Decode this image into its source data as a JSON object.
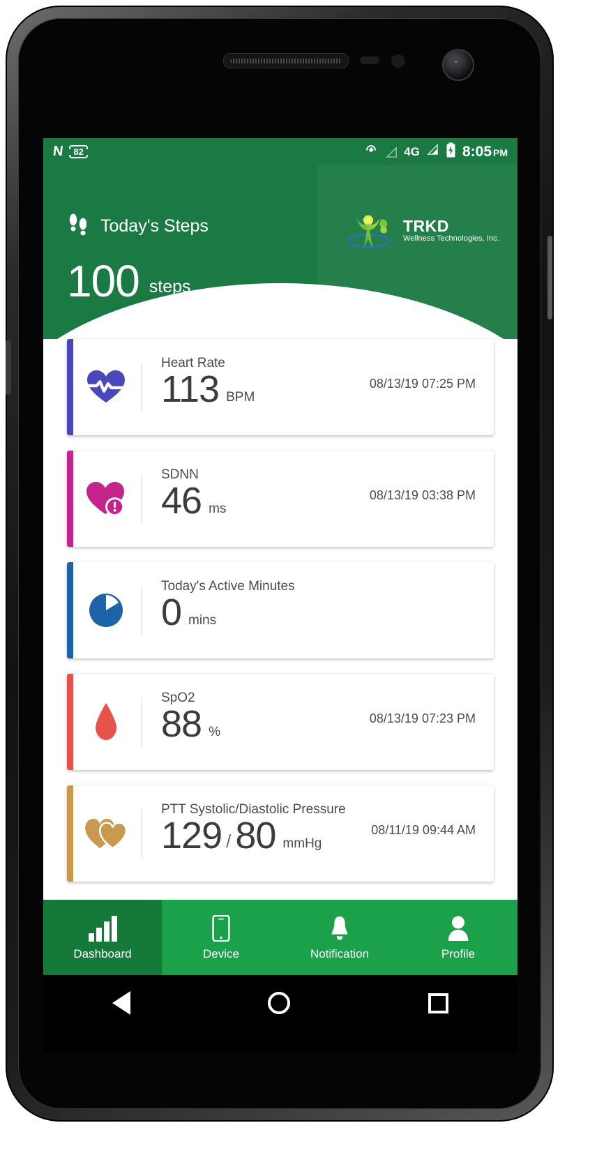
{
  "status_bar": {
    "notification_icon": "android-n-logo-icon",
    "battery_badge": "82",
    "icons": [
      "cast-icon",
      "signal-empty-icon",
      "signal-icon"
    ],
    "network": "4G",
    "time": "8:05",
    "ampm": "PM"
  },
  "header": {
    "steps_icon": "footsteps-icon",
    "steps_title": "Today's Steps",
    "steps_value": "100",
    "steps_unit": "steps",
    "brand_logo": "trkd-wellness-logo-icon",
    "brand_name": "TRKD",
    "brand_tagline": "Wellness Technologies, Inc.",
    "bg_color": "#1b7a43"
  },
  "cards": [
    {
      "name": "heart-rate",
      "icon": "heart-pulse-icon",
      "label": "Heart Rate",
      "value": "113",
      "unit": "BPM",
      "timestamp": "08/13/19 07:25 PM",
      "accent": "#4a47bb"
    },
    {
      "name": "sdnn",
      "icon": "heart-alert-icon",
      "label": "SDNN",
      "value": "46",
      "unit": "ms",
      "timestamp": "08/13/19 03:38 PM",
      "accent": "#c5248c"
    },
    {
      "name": "active-minutes",
      "icon": "pie-clock-icon",
      "label": "Today's Active Minutes",
      "value": "0",
      "unit": "mins",
      "timestamp": "",
      "accent": "#1d63a8"
    },
    {
      "name": "spo2",
      "icon": "blood-drop-icon",
      "label": "SpO2",
      "value": "88",
      "unit": "%",
      "timestamp": "08/13/19 07:23 PM",
      "accent": "#e8524c"
    },
    {
      "name": "ptt-pressure",
      "icon": "double-heart-icon",
      "label": "PTT Systolic/Diastolic Pressure",
      "value": "129",
      "value2": "80",
      "separator": "/",
      "unit": "mmHg",
      "timestamp": "08/11/19 09:44 AM",
      "accent": "#c99a4e"
    }
  ],
  "tabs": [
    {
      "label": "Dashboard",
      "icon": "bar-chart-icon",
      "active": true
    },
    {
      "label": "Device",
      "icon": "smartphone-icon",
      "active": false
    },
    {
      "label": "Notification",
      "icon": "bell-icon",
      "active": false
    },
    {
      "label": "Profile",
      "icon": "person-icon",
      "active": false
    }
  ],
  "android_nav": {
    "back": "back-triangle-icon",
    "home": "home-circle-icon",
    "recent": "recent-square-icon"
  }
}
